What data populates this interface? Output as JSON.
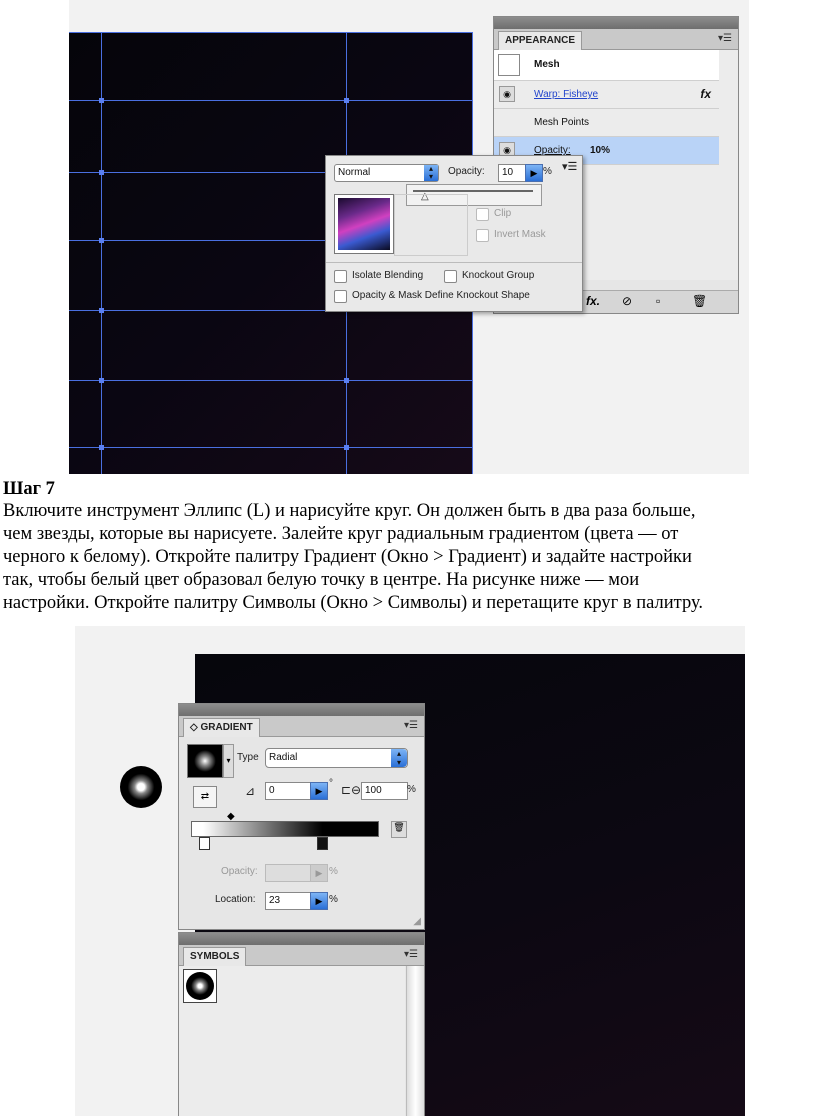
{
  "appearance_panel": {
    "tab": "APPEARANCE",
    "rows": [
      "Mesh",
      "Warp: Fisheye",
      "Mesh Points",
      "Opacity:"
    ],
    "opacity_value": "10%",
    "fx_label": "fx",
    "footer_fx": "fx."
  },
  "transparency_popup": {
    "blend_mode": "Normal",
    "opacity_label": "Opacity:",
    "opacity_value": "10",
    "percent": "%",
    "clip": "Clip",
    "invert_mask": "Invert Mask",
    "isolate_blending": "Isolate Blending",
    "knockout_group": "Knockout Group",
    "opacity_mask": "Opacity & Mask Define Knockout Shape"
  },
  "step": {
    "title": "Шаг 7",
    "lines": [
      "Включите инструмент Эллипс (L) и нарисуйте круг. Он должен быть в два раза больше,",
      "чем звезды, которые вы нарисуете. Залейте круг радиальным градиентом (цвета — от",
      "черного к белому). Откройте палитру Градиент (Окно > Градиент) и задайте настройки",
      "так, чтобы белый цвет образовал белую точку в центре. На рисунке ниже — мои",
      "настройки. Откройте палитру Символы (Окно > Символы) и перетащите круг в палитру."
    ]
  },
  "gradient_panel": {
    "tab": "GRADIENT",
    "type_label": "Type",
    "type_value": "Radial",
    "angle_value": "0",
    "degree": "°",
    "aspect_value": "100",
    "percent": "%",
    "opacity_label": "Opacity:",
    "location_label": "Location:",
    "location_value": "23"
  },
  "symbols_panel": {
    "tab": "SYMBOLS"
  }
}
